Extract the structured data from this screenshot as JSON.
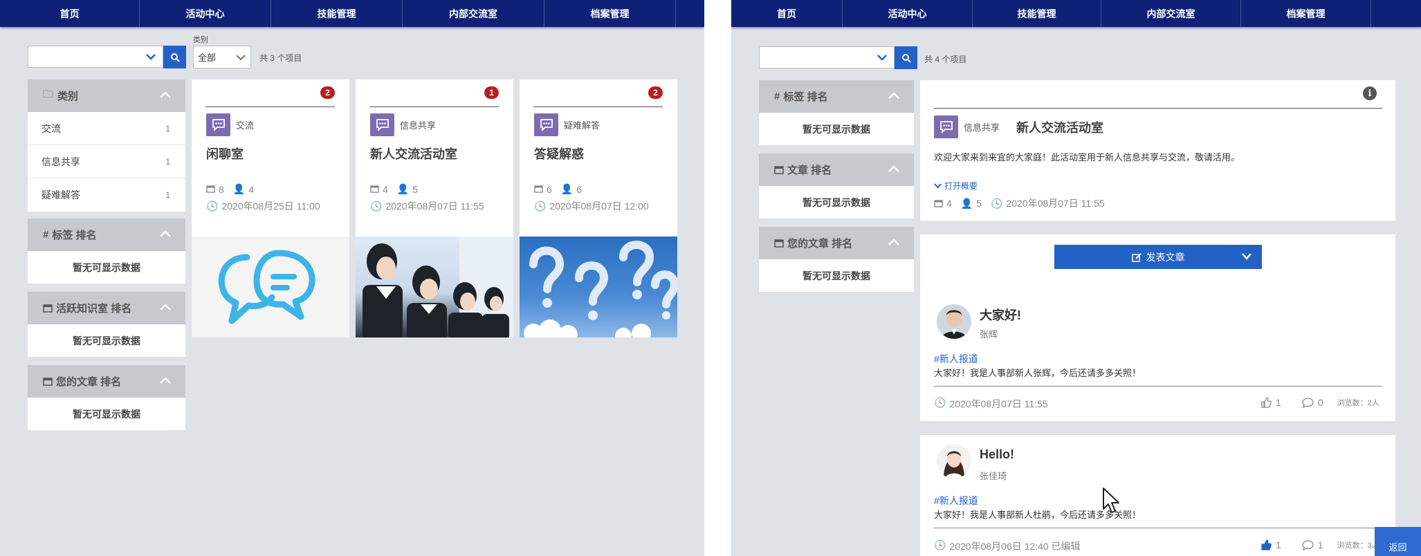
{
  "nav": [
    "首页",
    "活动中心",
    "技能管理",
    "内部交流室",
    "档案管理"
  ],
  "left": {
    "category_label": "类别",
    "category_value": "全部",
    "count_text": "共 3 个项目",
    "sidebar_category_title": "类别",
    "categories": [
      {
        "name": "交流",
        "count": "1"
      },
      {
        "name": "信息共享",
        "count": "1"
      },
      {
        "name": "疑难解答",
        "count": "1"
      }
    ],
    "tag_rank_title": "标签 排名",
    "active_room_rank_title": "活跃知识室 排名",
    "my_article_rank_title": "您的文章 排名",
    "no_data": "暂无可显示数据",
    "rooms": [
      {
        "badge": "2",
        "category": "交流",
        "title": "闲聊室",
        "articles": "8",
        "members": "4",
        "date": "2020年08月25日 11:00",
        "image": "chat-bubbles-illustration"
      },
      {
        "badge": "1",
        "category": "信息共享",
        "title": "新人交流活动室",
        "articles": "4",
        "members": "5",
        "date": "2020年08月07日 11:55",
        "image": "business-people-photo"
      },
      {
        "badge": "2",
        "category": "疑难解答",
        "title": "答疑解惑",
        "articles": "6",
        "members": "6",
        "date": "2020年08月07日 12:00",
        "image": "question-mark-clouds-photo"
      }
    ]
  },
  "right": {
    "count_text": "共 4 个项目",
    "tag_rank_title": "标签 排名",
    "article_rank_title": "文章 排名",
    "my_article_rank_title": "您的文章 排名",
    "no_data": "暂无可显示数据",
    "room": {
      "category": "信息共享",
      "title": "新人交流活动室",
      "description": "欢迎大家来到来宜的大家庭！此活动室用于新人信息共享与交流，敬请活用。",
      "expand_label": "打开概要",
      "articles": "4",
      "members": "5",
      "date": "2020年08月07日 11:55"
    },
    "post_button": "发表文章",
    "posts": [
      {
        "title": "大家好!",
        "author": "张辉",
        "tag": "#新人报道",
        "body": "大家好！我是人事部新人张辉，今后还请多多关照！",
        "date": "2020年08月07日 11:55",
        "likes": "1",
        "comments": "0",
        "views": "浏览数：2人"
      },
      {
        "title": "Hello!",
        "author": "张佳琦",
        "tag": "#新人报道",
        "body": "大家好！我是人事部新人杜鹃，今后还请多多关照！",
        "date": "2020年08月06日 12:40 已编辑",
        "likes": "1",
        "comments": "1",
        "views": "浏览数：3人"
      }
    ],
    "back_button": "返回"
  },
  "colors": {
    "nav": "#0e2176",
    "accent": "#2461c6",
    "badge": "#b52020",
    "bubble": "#7d6bb0",
    "background": "#dfe3e7"
  }
}
